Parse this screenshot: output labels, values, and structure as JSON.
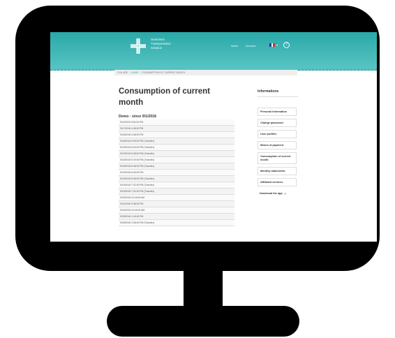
{
  "header": {
    "logo_lines": [
      "Seamless",
      "Transportation",
      "Solution"
    ],
    "nav": {
      "news": "News",
      "account": "Account"
    },
    "help_icon": "question-mark-icon",
    "flag_colors": [
      "#1e3a8a",
      "#ffffff",
      "#d32f2f"
    ]
  },
  "breadcrumb": {
    "you_are": "YOU ARE",
    "home": "HOME",
    "current": "CONSUMPTION OF CURRENT MONTH"
  },
  "main": {
    "title": "Consumption of current month",
    "list_heading": "Demo : since 9/1/2018",
    "items": [
      "9/11/2018 3:54:00 PM",
      "9/17/2018 4:08:00 PM",
      "9/18/2018 3:48:00 PM",
      "9/18/2018 5:59:00 PM (Transfer)",
      "9/19/2018 5:04:00 PM (Transfer)",
      "9/19/2018 5:08:00 PM (Transfer)",
      "9/19/2018 5:19:00 PM (Transfer)",
      "9/19/2018 5:48:00 PM (Transfer)",
      "9/19/2018 6:05:00 PM",
      "9/19/2018 6:08:00 PM (Transfer)",
      "9/19/2018 7:02:00 PM (Transfer)",
      "9/19/2018 7:02:00 PM (Transfer)",
      "9/20/2018 10:18:00 AM",
      "9/21/2018 3:38:00 PM",
      "9/24/2018 10:16:00 AM",
      "9/25/2018 1:18:00 PM",
      "9/25/2018 2:08:00 PM (Transfer)"
    ]
  },
  "sidebar": {
    "title": "Informations",
    "items": [
      "Personal information",
      "Change password",
      "User profiles",
      "Means of payment",
      "Consumption of current month",
      "Monthly statements",
      "Affiliated services",
      "Download the app"
    ]
  }
}
